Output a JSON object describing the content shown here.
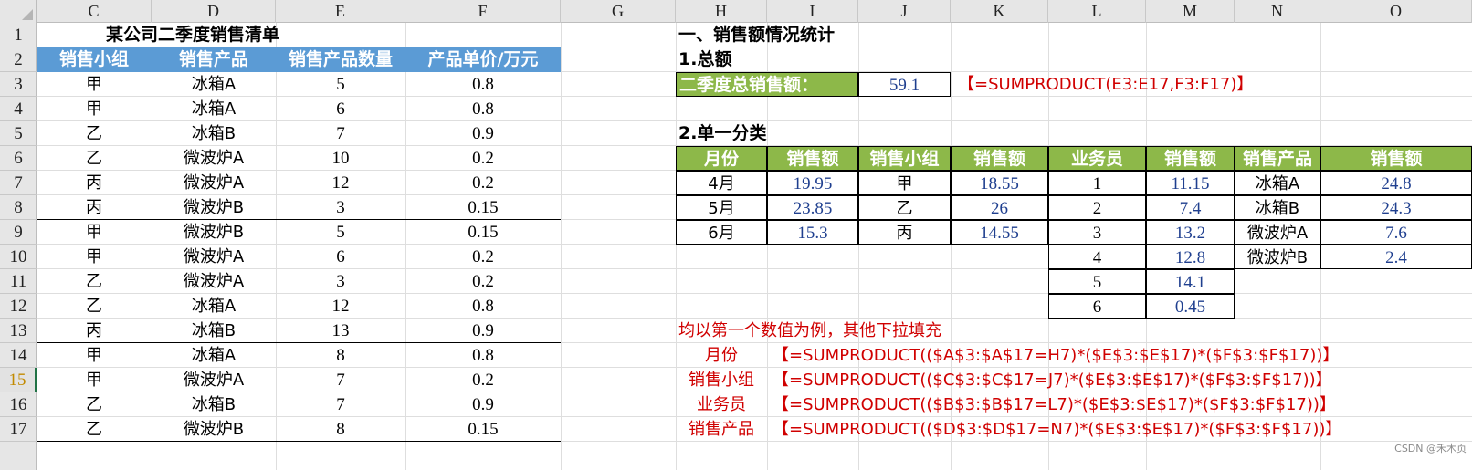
{
  "columns": [
    "C",
    "D",
    "E",
    "F",
    "G",
    "H",
    "I",
    "J",
    "K",
    "L",
    "M",
    "N",
    "O"
  ],
  "rows": [
    "1",
    "2",
    "3",
    "4",
    "5",
    "6",
    "7",
    "8",
    "9",
    "10",
    "11",
    "12",
    "13",
    "14",
    "15",
    "16",
    "17"
  ],
  "active_row": "15",
  "left_table": {
    "title": "某公司二季度销售清单",
    "headers": [
      "销售小组",
      "销售产品",
      "销售产品数量",
      "产品单价/万元"
    ],
    "rows": [
      [
        "甲",
        "冰箱A",
        "5",
        "0.8"
      ],
      [
        "甲",
        "冰箱A",
        "6",
        "0.8"
      ],
      [
        "乙",
        "冰箱B",
        "7",
        "0.9"
      ],
      [
        "乙",
        "微波炉A",
        "10",
        "0.2"
      ],
      [
        "丙",
        "微波炉A",
        "12",
        "0.2"
      ],
      [
        "丙",
        "微波炉B",
        "3",
        "0.15"
      ],
      [
        "甲",
        "微波炉B",
        "5",
        "0.15"
      ],
      [
        "甲",
        "微波炉A",
        "6",
        "0.2"
      ],
      [
        "乙",
        "微波炉A",
        "3",
        "0.2"
      ],
      [
        "乙",
        "冰箱A",
        "12",
        "0.8"
      ],
      [
        "丙",
        "冰箱B",
        "13",
        "0.9"
      ],
      [
        "甲",
        "冰箱A",
        "8",
        "0.8"
      ],
      [
        "甲",
        "微波炉A",
        "7",
        "0.2"
      ],
      [
        "乙",
        "冰箱B",
        "7",
        "0.9"
      ],
      [
        "乙",
        "微波炉B",
        "8",
        "0.15"
      ]
    ]
  },
  "stats": {
    "section_title": "一、销售额情况统计",
    "total_title": "1.总额",
    "total_label": "二季度总销售额：",
    "total_value": "59.1",
    "total_formula": "【=SUMPRODUCT(E3:E17,F3:F17)】",
    "single_title": "2.单一分类",
    "headers": [
      "月份",
      "销售额",
      "销售小组",
      "销售额",
      "业务员",
      "销售额",
      "销售产品",
      "销售额"
    ],
    "month": [
      [
        "4月",
        "19.95"
      ],
      [
        "5月",
        "23.85"
      ],
      [
        "6月",
        "15.3"
      ]
    ],
    "group": [
      [
        "甲",
        "18.55"
      ],
      [
        "乙",
        "26"
      ],
      [
        "丙",
        "14.55"
      ]
    ],
    "staff": [
      [
        "1",
        "11.15"
      ],
      [
        "2",
        "7.4"
      ],
      [
        "3",
        "13.2"
      ],
      [
        "4",
        "12.8"
      ],
      [
        "5",
        "14.1"
      ],
      [
        "6",
        "0.45"
      ]
    ],
    "product": [
      [
        "冰箱A",
        "24.8"
      ],
      [
        "冰箱B",
        "24.3"
      ],
      [
        "微波炉A",
        "7.6"
      ],
      [
        "微波炉B",
        "2.4"
      ]
    ],
    "note": "均以第一个数值为例，其他下拉填充",
    "formulas": [
      {
        "label": "月份",
        "formula": "【=SUMPRODUCT(($A$3:$A$17=H7)*($E$3:$E$17)*($F$3:$F$17))】"
      },
      {
        "label": "销售小组",
        "formula": "【=SUMPRODUCT(($C$3:$C$17=J7)*($E$3:$E$17)*($F$3:$F$17))】"
      },
      {
        "label": "业务员",
        "formula": "【=SUMPRODUCT(($B$3:$B$17=L7)*($E$3:$E$17)*($F$3:$F$17))】"
      },
      {
        "label": "销售产品",
        "formula": "【=SUMPRODUCT(($D$3:$D$17=N7)*($E$3:$E$17)*($F$3:$F$17))】"
      }
    ]
  },
  "watermark": "CSDN @禾木页",
  "colors": {
    "blue_header": "#5b9bd5",
    "green_header": "#8db849",
    "value_blue": "#1f3f8f",
    "formula_red": "#d00000"
  }
}
